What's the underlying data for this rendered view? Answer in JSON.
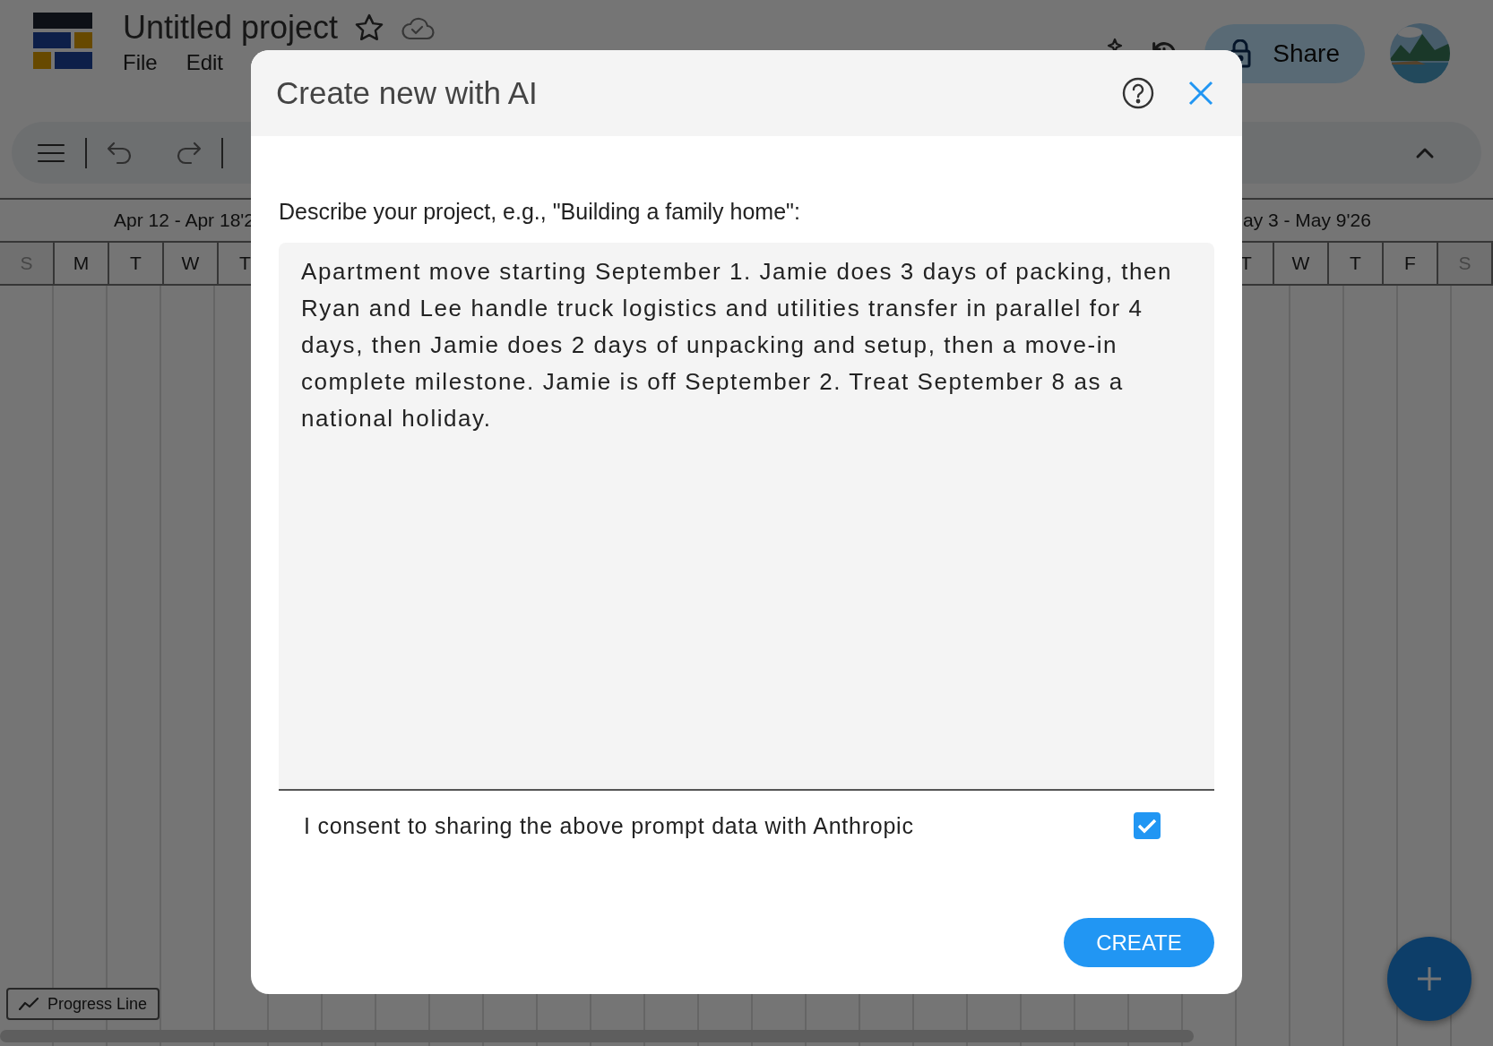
{
  "app": {
    "title": "Untitled project",
    "starred": false,
    "menu": [
      "File",
      "Edit"
    ],
    "share_label": "Share"
  },
  "timeline": {
    "left_week": "Apr 12 - Apr 18'2",
    "right_week": "ay 3 - May 9'26",
    "left_days": [
      {
        "label": "S",
        "weekend": true
      },
      {
        "label": "M",
        "weekend": false
      },
      {
        "label": "T",
        "weekend": false
      },
      {
        "label": "W",
        "weekend": false
      },
      {
        "label": "T",
        "weekend": false
      }
    ],
    "right_days": [
      {
        "label": "T",
        "weekend": false
      },
      {
        "label": "W",
        "weekend": false
      },
      {
        "label": "T",
        "weekend": false
      },
      {
        "label": "F",
        "weekend": false
      },
      {
        "label": "S",
        "weekend": true
      }
    ],
    "progress_line_label": "Progress Line"
  },
  "dialog": {
    "title": "Create new with AI",
    "prompt_label": "Describe your project, e.g., \"Building a family home\":",
    "prompt_value": "Apartment move starting September 1. Jamie does 3 days of packing, then Ryan and Lee handle truck logistics and utilities transfer in parallel for 4 days, then Jamie does 2 days of unpacking and setup, then a move-in complete milestone. Jamie is off September 2. Treat September 8 as a national holiday.",
    "consent_label": "I consent to sharing the above prompt data with Anthropic",
    "consent_checked": true,
    "create_label": "CREATE"
  }
}
